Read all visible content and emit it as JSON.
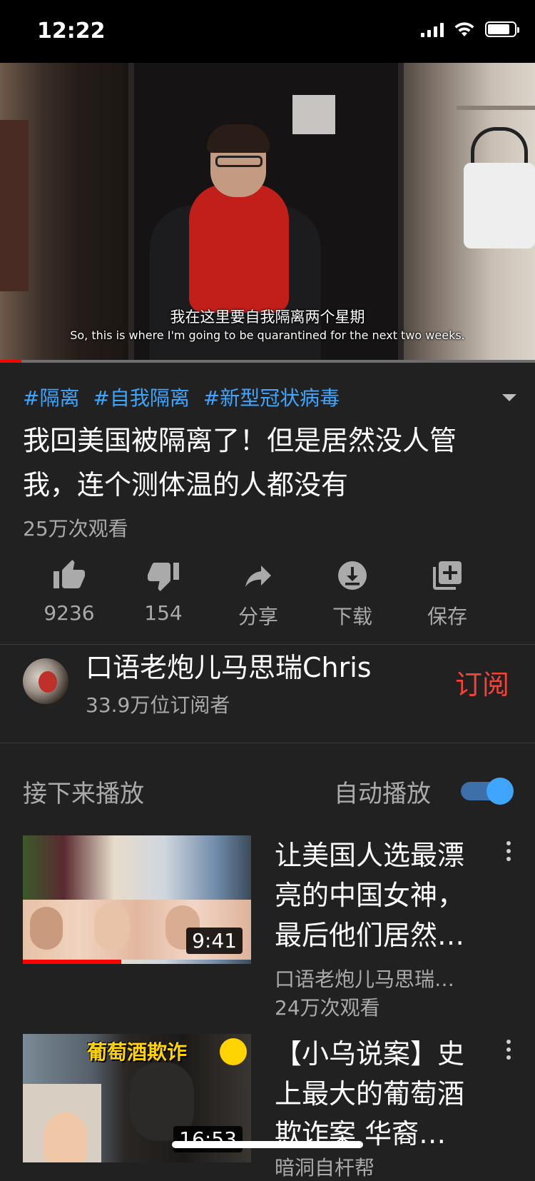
{
  "status_bar": {
    "time": "12:22"
  },
  "video": {
    "subtitle_zh": "我在这里要自我隔离两个星期",
    "subtitle_en": "So, this is where I'm going to be quarantined for the next two weeks.",
    "progress": 0.04
  },
  "hashtags": [
    "#隔离",
    "#自我隔离",
    "#新型冠状病毒"
  ],
  "title": "我回美国被隔离了！但是居然没人管我，连个测体温的人都没有",
  "views": "25万次观看",
  "actions": [
    {
      "label": "9236",
      "icon": "thumbs-up-icon"
    },
    {
      "label": "154",
      "icon": "thumbs-down-icon"
    },
    {
      "label": "分享",
      "icon": "share-icon"
    },
    {
      "label": "下载",
      "icon": "download-icon"
    },
    {
      "label": "保存",
      "icon": "save-playlist-icon"
    }
  ],
  "channel": {
    "name": "口语老炮儿马思瑞Chris",
    "subscribers": "33.9万位订阅者",
    "subscribe_label": "订阅"
  },
  "up_next": {
    "heading": "接下来播放",
    "autoplay_label": "自动播放",
    "autoplay_on": true
  },
  "recommendations": [
    {
      "title": "让美国人选最漂亮的中国女神，最后他们居然…",
      "channel": "口语老炮儿马思瑞…",
      "views": "24万次观看",
      "duration": "9:41",
      "watched": 0.43
    },
    {
      "title": "【小乌说案】史上最大的葡萄酒欺诈案 华裔…",
      "thumb_text": "葡萄酒欺诈",
      "channel": "暗洞自杆帮",
      "duration": "16:53"
    }
  ],
  "colors": {
    "background": "#212121",
    "link": "#3ea6ff",
    "subscribe": "#f44336",
    "progress": "#ff0000"
  }
}
